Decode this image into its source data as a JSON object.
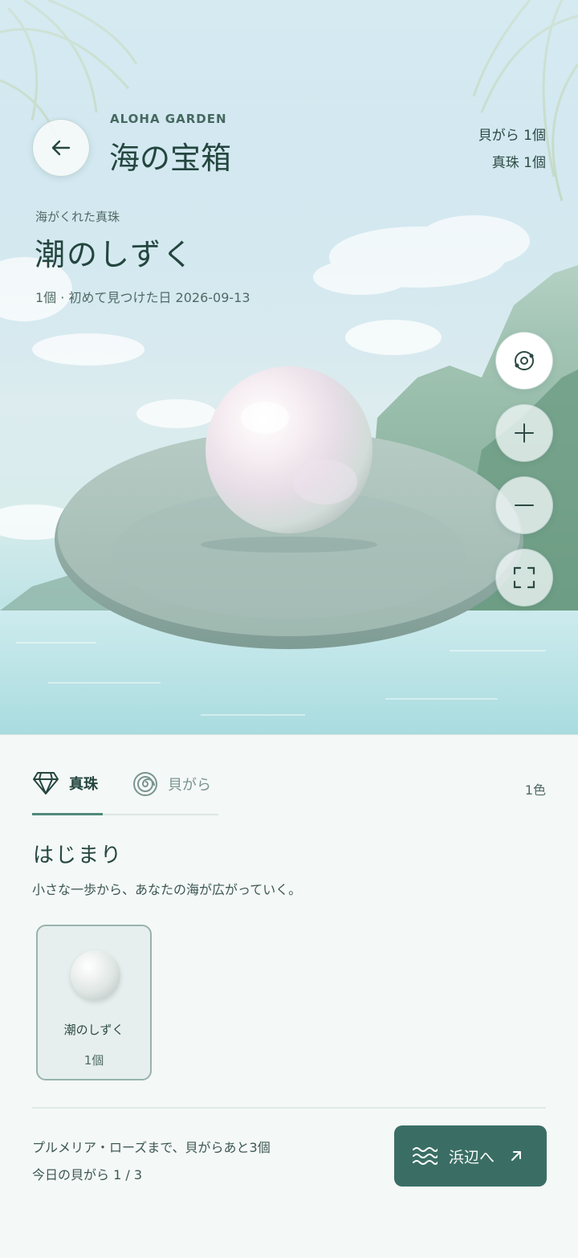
{
  "header": {
    "brand": "ALOHA GARDEN",
    "title": "海の宝箱",
    "shell_count": "貝がら 1個",
    "pearl_count": "真珠 1個"
  },
  "item": {
    "subtitle": "海がくれた真珠",
    "name": "潮のしずく",
    "meta": "1個 · 初めて見つけた日 2026-09-13"
  },
  "controls": [
    "rotate-icon",
    "zoom-in-icon",
    "zoom-out-icon",
    "fullscreen-icon"
  ],
  "tabs": {
    "pearl": "真珠",
    "shell": "貝がら",
    "color_count": "1色"
  },
  "section": {
    "title": "はじまり",
    "description": "小さな一歩から、あなたの海が広がっていく。"
  },
  "collection": [
    {
      "name": "潮のしずく",
      "count": "1個"
    }
  ],
  "footer": {
    "goal": "プルメリア・ローズまで、貝がらあと3個",
    "today": "今日の貝がら 1 / 3",
    "beach_button": "浜辺へ"
  },
  "colors": {
    "accent": "#3a6e64",
    "tab_underline": "#4e8a78",
    "text_dark": "#24463f"
  }
}
